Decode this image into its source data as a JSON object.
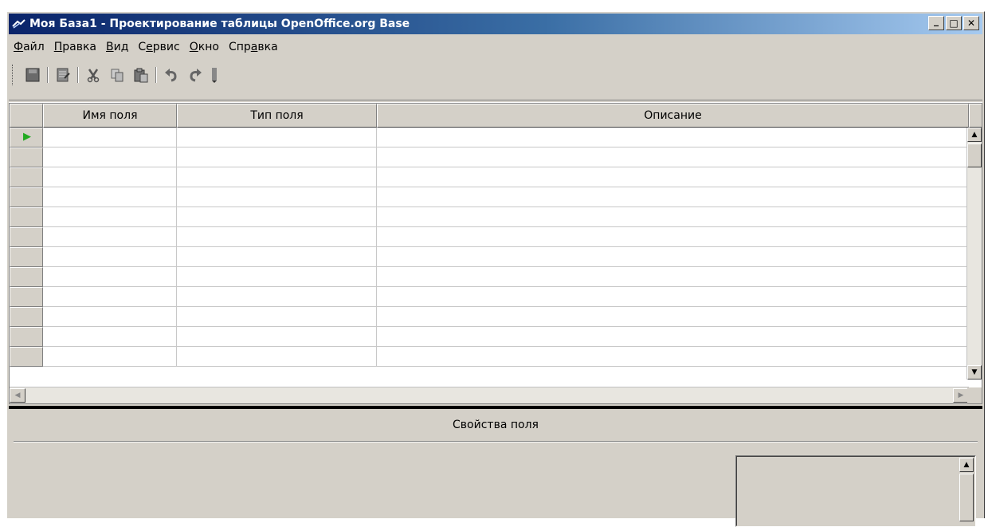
{
  "window": {
    "title": "Моя База1 - Проектирование таблицы OpenOffice.org Base",
    "controls": {
      "minimize": "_",
      "maximize": "□",
      "close": "✕"
    }
  },
  "menu": {
    "items": [
      {
        "label": "Файл",
        "accel": "Ф",
        "rest": "айл"
      },
      {
        "label": "Правка",
        "accel": "П",
        "rest": "равка"
      },
      {
        "label": "Вид",
        "accel": "В",
        "rest": "ид"
      },
      {
        "label": "Сервис",
        "pre": "С",
        "accel": "е",
        "rest": "рвис"
      },
      {
        "label": "Окно",
        "accel": "О",
        "rest": "кно"
      },
      {
        "label": "Справка",
        "pre": "Спр",
        "accel": "а",
        "rest": "вка"
      }
    ]
  },
  "toolbar": {
    "icons": [
      "save-icon",
      "edit-doc-icon",
      "cut-icon",
      "copy-icon",
      "paste-icon",
      "undo-icon",
      "redo-icon",
      "toolbar-overflow-icon"
    ]
  },
  "grid": {
    "columns": [
      "Имя поля",
      "Тип поля",
      "Описание"
    ],
    "row_count": 12,
    "current_row_indicator": "▶"
  },
  "properties": {
    "title": "Свойства поля"
  },
  "colors": {
    "title_bar_start": "#0a246a",
    "title_bar_end": "#a6caf0",
    "window_bg": "#d4d0c8",
    "row_indicator": "#22aa22"
  }
}
